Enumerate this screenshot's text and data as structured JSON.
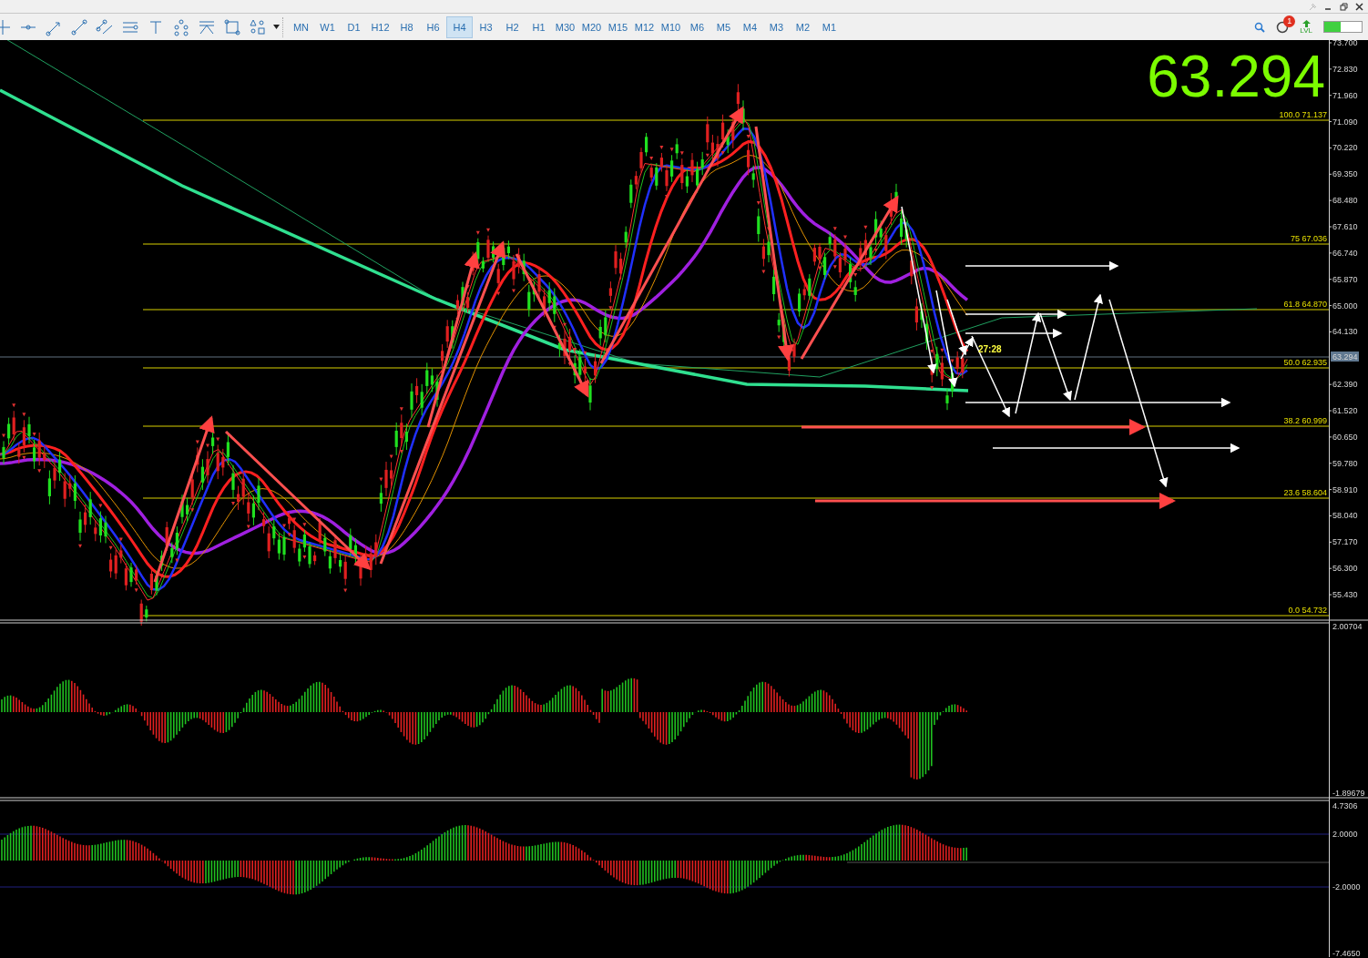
{
  "toolbar": {
    "timeframes": [
      {
        "label": "MN",
        "selected": false
      },
      {
        "label": "W1",
        "selected": false
      },
      {
        "label": "D1",
        "selected": false
      },
      {
        "label": "H12",
        "selected": false
      },
      {
        "label": "H8",
        "selected": false
      },
      {
        "label": "H6",
        "selected": false
      },
      {
        "label": "H4",
        "selected": true
      },
      {
        "label": "H3",
        "selected": false
      },
      {
        "label": "H2",
        "selected": false
      },
      {
        "label": "H1",
        "selected": false
      },
      {
        "label": "M30",
        "selected": false
      },
      {
        "label": "M20",
        "selected": false
      },
      {
        "label": "M15",
        "selected": false
      },
      {
        "label": "M12",
        "selected": false
      },
      {
        "label": "M10",
        "selected": false
      },
      {
        "label": "M6",
        "selected": false
      },
      {
        "label": "M5",
        "selected": false
      },
      {
        "label": "M4",
        "selected": false
      },
      {
        "label": "M3",
        "selected": false
      },
      {
        "label": "M2",
        "selected": false
      },
      {
        "label": "M1",
        "selected": false
      }
    ],
    "notification_count": "1",
    "level_label": "LVL",
    "level": 0.45
  },
  "chart": {
    "big_price": "63.294",
    "countdown": "27:28",
    "current_price": "63.294",
    "price_axis": [
      "73.700",
      "72.830",
      "71.960",
      "71.090",
      "70.220",
      "69.350",
      "68.480",
      "67.610",
      "66.740",
      "65.870",
      "65.000",
      "64.130",
      "62.390",
      "61.520",
      "60.650",
      "59.780",
      "58.910",
      "58.040",
      "57.170",
      "56.300",
      "55.430"
    ],
    "fib_levels": [
      "100.0  71.137",
      "75  67.036",
      "61.8  64.870",
      "50.0  62.935",
      "38.2  60.999",
      "23.6  58.604",
      "0.0  54.732"
    ]
  },
  "indicator_1": {
    "axis": [
      "2.00704",
      "-1.89679"
    ]
  },
  "indicator_2": {
    "axis": [
      "4.7306",
      "2.0000",
      "-2.0000",
      "-7.4650"
    ]
  }
}
